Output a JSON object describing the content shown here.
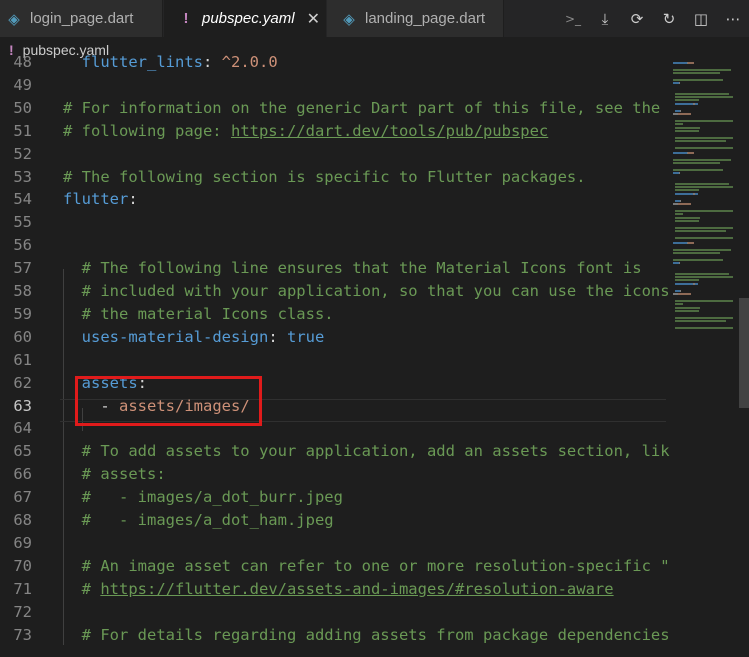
{
  "tabs": [
    {
      "label": "login_page.dart",
      "icon": "dart-file-icon",
      "active": false
    },
    {
      "label": "pubspec.yaml",
      "icon": "yaml-file-icon",
      "active": true,
      "close": "✕"
    },
    {
      "label": "landing_page.dart",
      "icon": "dart-file-icon",
      "active": false
    }
  ],
  "breadcrumb": {
    "icon": "!",
    "label": "pubspec.yaml"
  },
  "actions": [
    "terminal-icon",
    "download-icon",
    "sync-icon",
    "refresh-icon",
    "split-editor-icon",
    "more-icon"
  ],
  "lines": [
    {
      "n": "48",
      "parts": [
        [
          "key",
          "  flutter_lints"
        ],
        [
          "plain",
          ": "
        ],
        [
          "str",
          "^2.0.0"
        ]
      ]
    },
    {
      "n": "49",
      "parts": []
    },
    {
      "n": "50",
      "parts": [
        [
          "cm",
          "# For information on the generic Dart part of this file, see the"
        ]
      ]
    },
    {
      "n": "51",
      "parts": [
        [
          "cm",
          "# following page: "
        ],
        [
          "cmu",
          "https://dart.dev/tools/pub/pubspec"
        ]
      ]
    },
    {
      "n": "52",
      "parts": []
    },
    {
      "n": "53",
      "parts": [
        [
          "cm",
          "# The following section is specific to Flutter packages."
        ]
      ]
    },
    {
      "n": "54",
      "parts": [
        [
          "key",
          "flutter"
        ],
        [
          "plain",
          ":"
        ]
      ]
    },
    {
      "n": "55",
      "parts": []
    },
    {
      "n": "56",
      "parts": []
    },
    {
      "n": "57",
      "parts": [
        [
          "plain",
          "  "
        ],
        [
          "cm",
          "# The following line ensures that the Material Icons font is"
        ]
      ]
    },
    {
      "n": "58",
      "parts": [
        [
          "plain",
          "  "
        ],
        [
          "cm",
          "# included with your application, so that you can use the icons in"
        ]
      ]
    },
    {
      "n": "59",
      "parts": [
        [
          "plain",
          "  "
        ],
        [
          "cm",
          "# the material Icons class."
        ]
      ]
    },
    {
      "n": "60",
      "parts": [
        [
          "plain",
          "  "
        ],
        [
          "key",
          "uses-material-design"
        ],
        [
          "plain",
          ": "
        ],
        [
          "bool",
          "true"
        ]
      ]
    },
    {
      "n": "61",
      "parts": []
    },
    {
      "n": "62",
      "parts": [
        [
          "plain",
          "  "
        ],
        [
          "key",
          "assets"
        ],
        [
          "plain",
          ":"
        ]
      ]
    },
    {
      "n": "63",
      "parts": [
        [
          "plain",
          "    - "
        ],
        [
          "str",
          "assets/images/"
        ]
      ],
      "active": true
    },
    {
      "n": "64",
      "parts": []
    },
    {
      "n": "65",
      "parts": [
        [
          "plain",
          "  "
        ],
        [
          "cm",
          "# To add assets to your application, add an assets section, like this:"
        ]
      ]
    },
    {
      "n": "66",
      "parts": [
        [
          "plain",
          "  "
        ],
        [
          "cm",
          "# assets:"
        ]
      ]
    },
    {
      "n": "67",
      "parts": [
        [
          "plain",
          "  "
        ],
        [
          "cm",
          "#   - images/a_dot_burr.jpeg"
        ]
      ]
    },
    {
      "n": "68",
      "parts": [
        [
          "plain",
          "  "
        ],
        [
          "cm",
          "#   - images/a_dot_ham.jpeg"
        ]
      ]
    },
    {
      "n": "69",
      "parts": []
    },
    {
      "n": "70",
      "parts": [
        [
          "plain",
          "  "
        ],
        [
          "cm",
          "# An image asset can refer to one or more resolution-specific \"var"
        ]
      ]
    },
    {
      "n": "71",
      "parts": [
        [
          "plain",
          "  "
        ],
        [
          "cm",
          "# "
        ],
        [
          "cmu",
          "https://flutter.dev/assets-and-images/#resolution-aware"
        ]
      ]
    },
    {
      "n": "72",
      "parts": []
    },
    {
      "n": "73",
      "parts": [
        [
          "plain",
          "  "
        ],
        [
          "cm",
          "# For details regarding adding assets from package dependencies, see"
        ]
      ]
    }
  ]
}
